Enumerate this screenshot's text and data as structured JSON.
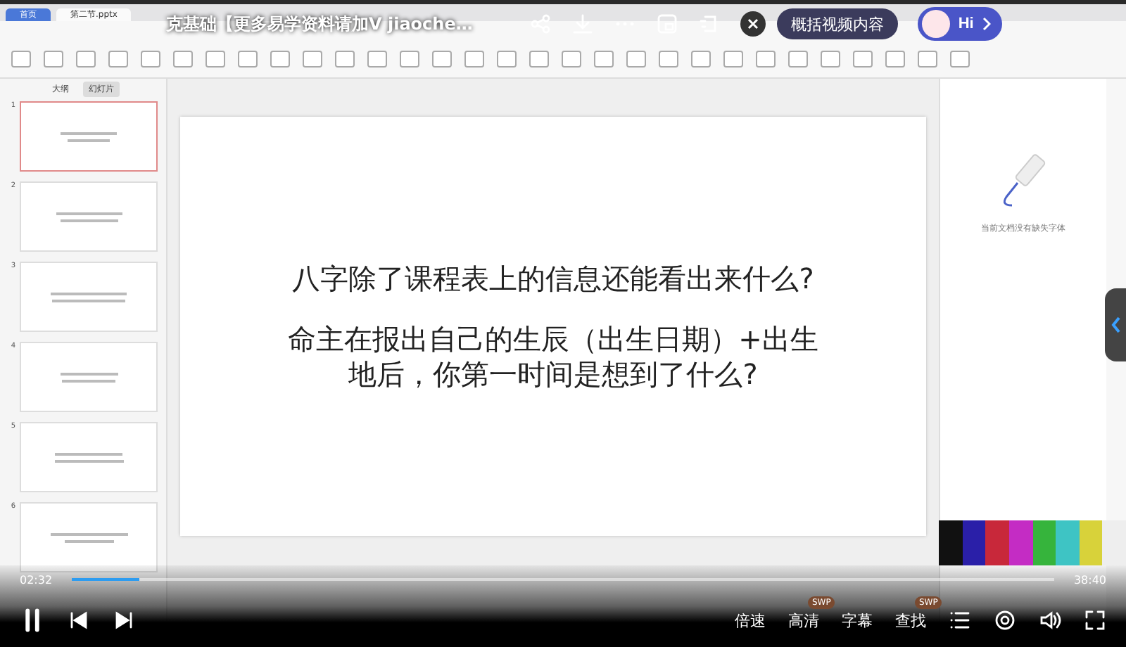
{
  "app_tabs": [
    {
      "label": "首页",
      "selected": false
    },
    {
      "label": "第二节.pptx",
      "selected": true
    }
  ],
  "video_title": "克基础【更多易学资料请加V jiaoche…",
  "overlay": {
    "summary_button": "概括视频内容",
    "assistant_button": "Hi"
  },
  "panel_tabs": [
    {
      "label": "大纲",
      "selected": false
    },
    {
      "label": "幻灯片",
      "selected": true
    }
  ],
  "slides": [
    {
      "number": "1",
      "selected": true
    },
    {
      "number": "2",
      "selected": false
    },
    {
      "number": "3",
      "selected": false
    },
    {
      "number": "4",
      "selected": false
    },
    {
      "number": "5",
      "selected": false
    },
    {
      "number": "6",
      "selected": false
    }
  ],
  "slide": {
    "lines": [
      "八字除了课程表上的信息还能看出来什么?",
      "命主在报出自己的生辰（出生日期）+出生地后，你第一时间是想到了什么?"
    ]
  },
  "right_panel": {
    "message": "当前文档没有缺失字体"
  },
  "player": {
    "elapsed": "02:32",
    "duration": "38:40",
    "level": 0.068,
    "paused": false,
    "options": [
      {
        "label": "倍速"
      },
      {
        "label": "高清",
        "badge": "SWP"
      },
      {
        "label": "字幕"
      },
      {
        "label": "查找",
        "badge": "SWP"
      }
    ]
  }
}
